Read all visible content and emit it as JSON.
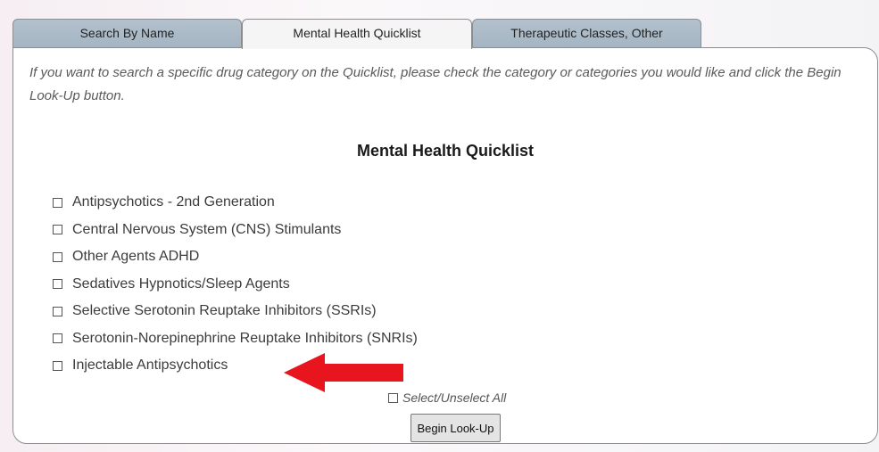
{
  "tabs": [
    {
      "label": "Search By Name"
    },
    {
      "label": "Mental Health Quicklist"
    },
    {
      "label": "Therapeutic Classes, Other"
    }
  ],
  "active_tab": "Mental Health Quicklist",
  "intro_text": "If you want to search a specific drug category on the Quicklist, please check the category or categories you would like and click the Begin Look-Up button.",
  "section_title": "Mental Health Quicklist",
  "categories": [
    {
      "label": "Antipsychotics - 2nd Generation",
      "checked": false
    },
    {
      "label": "Central Nervous System (CNS) Stimulants",
      "checked": false
    },
    {
      "label": "Other Agents ADHD",
      "checked": false
    },
    {
      "label": "Sedatives Hypnotics/Sleep Agents",
      "checked": false
    },
    {
      "label": "Selective Serotonin Reuptake Inhibitors (SSRIs)",
      "checked": false
    },
    {
      "label": "Serotonin-Norepinephrine Reuptake Inhibitors (SNRIs)",
      "checked": false
    },
    {
      "label": "Injectable Antipsychotics",
      "checked": false
    }
  ],
  "select_all_label": "Select/Unselect All",
  "begin_button_label": "Begin Look-Up",
  "colors": {
    "tab_inactive": "#a9b8c5",
    "tab_active": "#f5f5f5",
    "annotation_arrow": "#e8141e"
  },
  "annotation": {
    "type": "arrow",
    "icon": "red-arrow-icon",
    "points_to": "Injectable Antipsychotics"
  }
}
